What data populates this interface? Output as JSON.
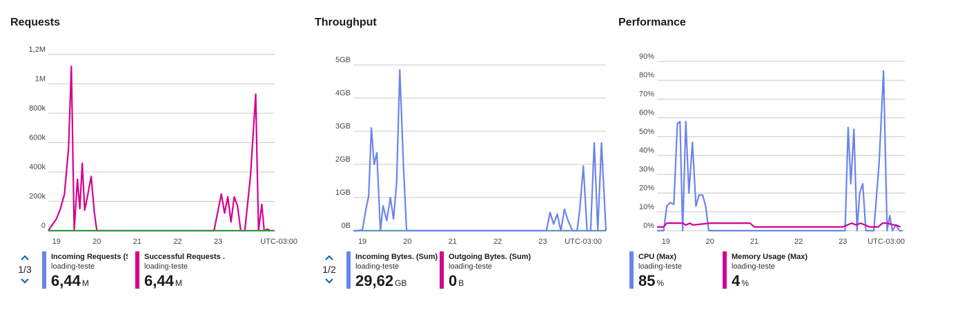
{
  "colors": {
    "blue": "#6b84ea",
    "magenta": "#d5008f",
    "green": "#2e9a3a",
    "teal": "#5a9bb5",
    "grid": "#c8c8c8"
  },
  "icons": {
    "pager_up": "chevron-up-icon",
    "pager_down": "chevron-down-icon"
  },
  "chart_data": [
    {
      "type": "line",
      "title": "Requests",
      "xlabel": "UTC-03:00",
      "ylabel": "",
      "y_ticks": [
        "0",
        "200k",
        "400k",
        "600k",
        "800k",
        "1M",
        "1,2M"
      ],
      "ylim": [
        0,
        1200000
      ],
      "x_ticks": [
        "19",
        "20",
        "21",
        "22",
        "23"
      ],
      "xlim": [
        18.8,
        24.4
      ],
      "grid": true,
      "series": [
        {
          "name": "Successful Requests ...",
          "color": "#d5008f",
          "x": [
            18.8,
            19.0,
            19.1,
            19.2,
            19.3,
            19.37,
            19.44,
            19.52,
            19.58,
            19.64,
            19.7,
            19.78,
            19.86,
            19.94,
            20.0,
            20.08,
            22.9,
            23.08,
            23.16,
            23.24,
            23.32,
            23.4,
            23.48,
            23.56,
            23.66,
            23.8,
            23.93,
            24.0,
            24.08,
            24.14,
            24.22,
            24.3
          ],
          "y": [
            0,
            80000,
            150000,
            250000,
            560000,
            1120000,
            0,
            350000,
            150000,
            460000,
            140000,
            250000,
            370000,
            120000,
            0,
            0,
            0,
            250000,
            120000,
            230000,
            60000,
            230000,
            170000,
            0,
            0,
            370000,
            930000,
            0,
            180000,
            0,
            10000,
            0
          ]
        },
        {
          "name": "Incoming Requests (Sum)",
          "color": "#2e9a3a",
          "x": [
            18.8,
            24.4
          ],
          "y": [
            0,
            0
          ]
        }
      ]
    },
    {
      "type": "line",
      "title": "Throughput",
      "xlabel": "UTC-03:00",
      "ylabel": "",
      "y_ticks": [
        "0B",
        "1GB",
        "2GB",
        "3GB",
        "4GB",
        "5GB"
      ],
      "ylim": [
        0,
        5
      ],
      "x_ticks": [
        "19",
        "20",
        "21",
        "22",
        "23"
      ],
      "xlim": [
        18.8,
        24.4
      ],
      "grid": true,
      "series": [
        {
          "name": "Outgoing Bytes. (Sum)",
          "color": "#5a9bb5",
          "x": [
            18.8,
            24.4
          ],
          "y": [
            0,
            0
          ]
        },
        {
          "name": "Incoming Bytes. (Sum)",
          "color": "#6b84ea",
          "x": [
            18.8,
            18.9,
            19.0,
            19.08,
            19.14,
            19.2,
            19.26,
            19.32,
            19.4,
            19.46,
            19.54,
            19.62,
            19.69,
            19.76,
            19.83,
            19.91,
            19.98,
            20.05,
            20.14,
            20.2,
            23.0,
            23.08,
            23.16,
            23.24,
            23.32,
            23.4,
            23.48,
            23.56,
            23.66,
            23.76,
            23.82,
            23.9,
            23.98,
            24.06,
            24.14,
            24.22,
            24.3,
            24.4
          ],
          "y": [
            0,
            0,
            0.02,
            0.65,
            1.05,
            3.1,
            2.0,
            2.35,
            0,
            0.75,
            0.3,
            1.0,
            0.35,
            1.45,
            4.85,
            2.0,
            0,
            0,
            0,
            0,
            0,
            0,
            0.55,
            0.2,
            0.5,
            0,
            0.65,
            0.3,
            0,
            0,
            0.65,
            1.95,
            0,
            0,
            2.65,
            0,
            2.65,
            0
          ]
        }
      ]
    },
    {
      "type": "line",
      "title": "Performance",
      "xlabel": "UTC-03:00",
      "ylabel": "",
      "y_ticks": [
        "0%",
        "10%",
        "20%",
        "30%",
        "40%",
        "50%",
        "60%",
        "70%",
        "80%",
        "90%"
      ],
      "ylim": [
        0,
        90
      ],
      "x_ticks": [
        "19",
        "20",
        "21",
        "22",
        "23"
      ],
      "xlim": [
        18.8,
        24.4
      ],
      "grid": true,
      "series": [
        {
          "name": "CPU (Max)",
          "color": "#6b84ea",
          "x": [
            18.8,
            18.95,
            19.02,
            19.1,
            19.18,
            19.26,
            19.32,
            19.38,
            19.45,
            19.52,
            19.6,
            19.68,
            19.75,
            19.83,
            19.9,
            19.97,
            20.04,
            20.12,
            20.2,
            23.0,
            23.05,
            23.12,
            23.18,
            23.25,
            23.32,
            23.38,
            23.45,
            23.52,
            23.6,
            23.7,
            23.82,
            23.92,
            24.0,
            24.06,
            24.12,
            24.2,
            24.28,
            24.35
          ],
          "y": [
            0,
            0,
            13,
            15,
            14,
            57,
            58,
            0,
            58,
            20,
            47,
            13,
            19,
            19,
            13,
            0,
            0,
            0,
            0,
            0,
            0,
            55,
            25,
            54,
            0,
            20,
            25,
            0,
            0,
            0,
            36,
            85,
            0,
            8,
            0,
            3,
            0,
            0
          ]
        },
        {
          "name": "Memory Usage (Max)",
          "color": "#d5008f",
          "x": [
            18.8,
            18.95,
            19.02,
            19.38,
            19.45,
            19.55,
            19.6,
            20.0,
            20.9,
            21.0,
            23.0,
            23.1,
            23.2,
            23.3,
            23.4,
            23.5,
            23.6,
            23.8,
            23.9,
            24.0,
            24.15,
            24.2,
            24.3
          ],
          "y": [
            2,
            2,
            4,
            4,
            3,
            4,
            3,
            4,
            4,
            2,
            2,
            3,
            4,
            3,
            4,
            3,
            2,
            2,
            4,
            4,
            3,
            3,
            2
          ]
        }
      ]
    }
  ],
  "panels": [
    {
      "pager": "1/3",
      "legend": [
        {
          "name": "Incoming Requests (Sum",
          "sub": "loading-teste",
          "value": "6,44",
          "unit": "M",
          "color": "#6b84ea"
        },
        {
          "name": "Successful Requests ...",
          "sub": "loading-teste",
          "value": "6,44",
          "unit": "M",
          "color": "#d5008f"
        }
      ]
    },
    {
      "pager": "1/2",
      "legend": [
        {
          "name": "Incoming Bytes. (Sum)",
          "sub": "loading-teste",
          "value": "29,62",
          "unit": "GB",
          "color": "#6b84ea"
        },
        {
          "name": "Outgoing Bytes. (Sum)",
          "sub": "loading-teste",
          "value": "0",
          "unit": "B",
          "color": "#d5008f"
        }
      ]
    },
    {
      "pager": "",
      "legend": [
        {
          "name": "CPU (Max)",
          "sub": "loading-teste",
          "value": "85",
          "unit": "%",
          "color": "#6b84ea"
        },
        {
          "name": "Memory Usage (Max)",
          "sub": "loading-teste",
          "value": "4",
          "unit": "%",
          "color": "#d5008f"
        }
      ]
    }
  ]
}
